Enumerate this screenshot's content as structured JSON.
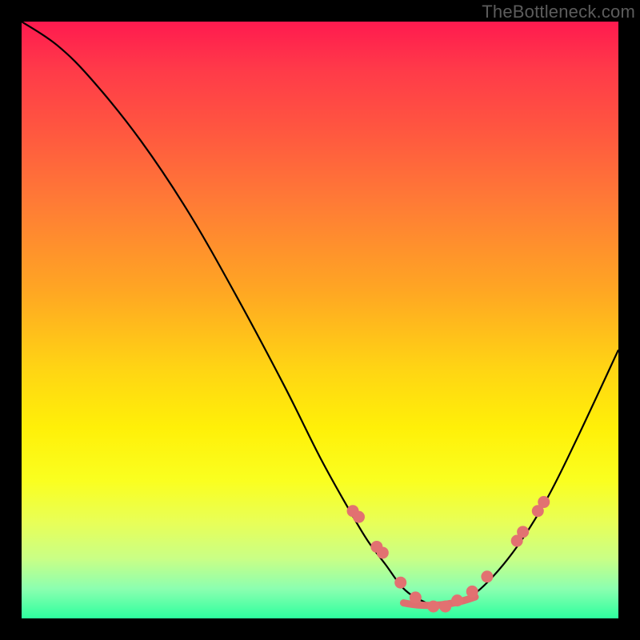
{
  "watermark": "TheBottleneck.com",
  "colors": {
    "gradient_top": "#ff1a4f",
    "gradient_bottom": "#2dff9e",
    "curve": "#000000",
    "dots": "#e27171",
    "frame": "#000000"
  },
  "chart_data": {
    "type": "line",
    "title": "",
    "xlabel": "",
    "ylabel": "",
    "xlim": [
      0,
      100
    ],
    "ylim": [
      0,
      100
    ],
    "grid": false,
    "legend": false,
    "annotations": [
      "TheBottleneck.com"
    ],
    "series": [
      {
        "name": "bottleneck-curve",
        "x": [
          0,
          6,
          12,
          20,
          28,
          36,
          44,
          50,
          55,
          58,
          61,
          64,
          67,
          70,
          74,
          78,
          83,
          88,
          93,
          100
        ],
        "values": [
          100,
          96,
          90,
          80,
          68,
          54,
          39,
          27,
          18,
          13,
          9,
          5,
          3,
          2,
          3,
          6,
          12,
          20,
          30,
          45
        ]
      }
    ],
    "markers": {
      "name": "highlighted-points",
      "x": [
        55.5,
        56.5,
        59.5,
        60.5,
        63.5,
        66,
        69,
        71,
        73,
        75.5,
        78,
        83,
        84,
        86.5,
        87.5
      ],
      "values": [
        18,
        17,
        12,
        11,
        6,
        3.5,
        2,
        2,
        3,
        4.5,
        7,
        13,
        14.5,
        18,
        19.5
      ]
    }
  }
}
